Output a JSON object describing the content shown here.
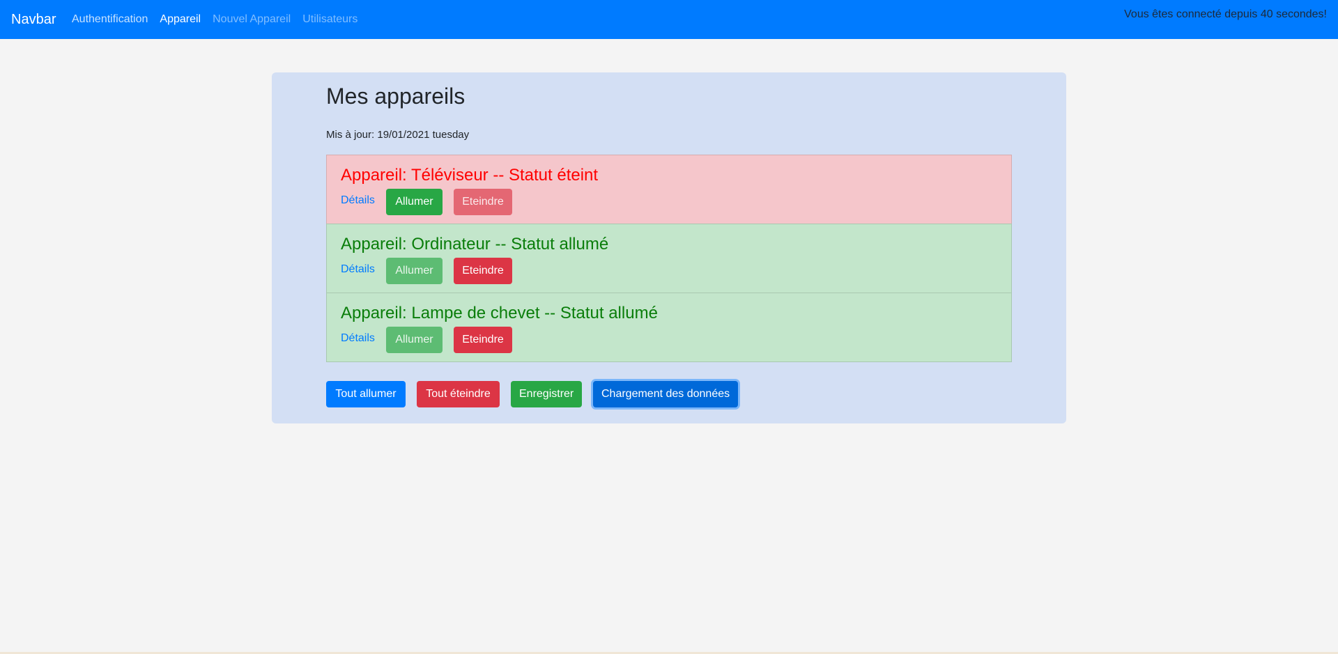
{
  "navbar": {
    "brand": "Navbar",
    "links": [
      {
        "label": "Authentification",
        "state": "normal"
      },
      {
        "label": "Appareil",
        "state": "active"
      },
      {
        "label": "Nouvel Appareil",
        "state": "disabled"
      },
      {
        "label": "Utilisateurs",
        "state": "disabled"
      }
    ],
    "status": "Vous êtes connecté depuis 40 secondes!"
  },
  "main": {
    "title": "Mes appareils",
    "updated": "Mis à jour: 19/01/2021 tuesday",
    "devices": [
      {
        "title": "Appareil: Téléviseur -- Statut éteint",
        "status": "off",
        "details_label": "Détails",
        "on_label": "Allumer",
        "off_label": "Eteindre"
      },
      {
        "title": "Appareil: Ordinateur -- Statut allumé",
        "status": "on",
        "details_label": "Détails",
        "on_label": "Allumer",
        "off_label": "Eteindre"
      },
      {
        "title": "Appareil: Lampe de chevet -- Statut allumé",
        "status": "on",
        "details_label": "Détails",
        "on_label": "Allumer",
        "off_label": "Eteindre"
      }
    ],
    "actions": {
      "all_on": "Tout allumer",
      "all_off": "Tout éteindre",
      "save": "Enregistrer",
      "load": "Chargement des données"
    }
  },
  "colors": {
    "navbar": "#007bff",
    "panel": "#d3dff4",
    "device_off_bg": "#f5c6cb",
    "device_on_bg": "#c3e6cb",
    "device_off_text": "#ff0000",
    "device_on_text": "#0a7d0a",
    "success": "#28a745",
    "danger": "#dc3545",
    "primary": "#007bff"
  }
}
